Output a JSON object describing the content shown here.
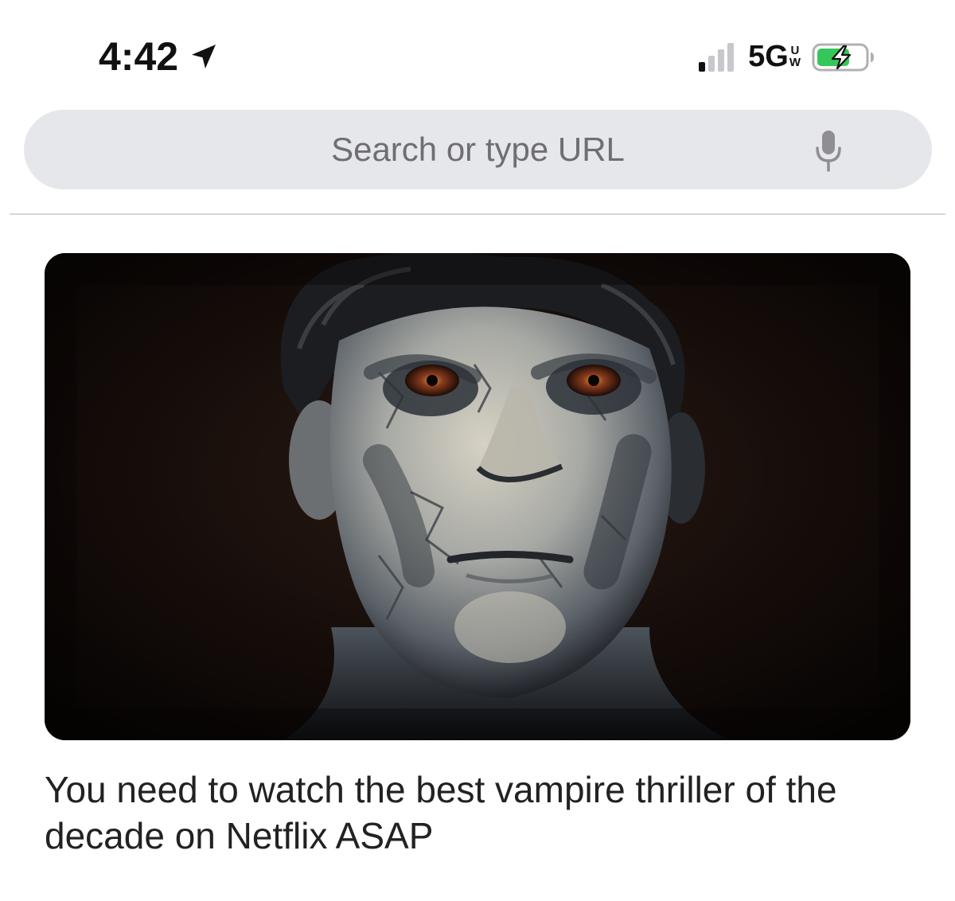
{
  "status_bar": {
    "time": "4:42",
    "network": "5G",
    "network_badge_top": "U",
    "network_badge_bottom": "W",
    "location_icon": "location-arrow-icon",
    "signal_icon": "cellular-signal-icon",
    "battery_icon": "battery-charging-icon",
    "battery_color": "#34c759"
  },
  "search": {
    "placeholder": "Search or type URL",
    "mic_icon": "microphone-icon"
  },
  "article": {
    "image_description_icon": "article-image",
    "headline": "You need to watch the best vampire thriller of the decade on Netflix ASAP"
  }
}
